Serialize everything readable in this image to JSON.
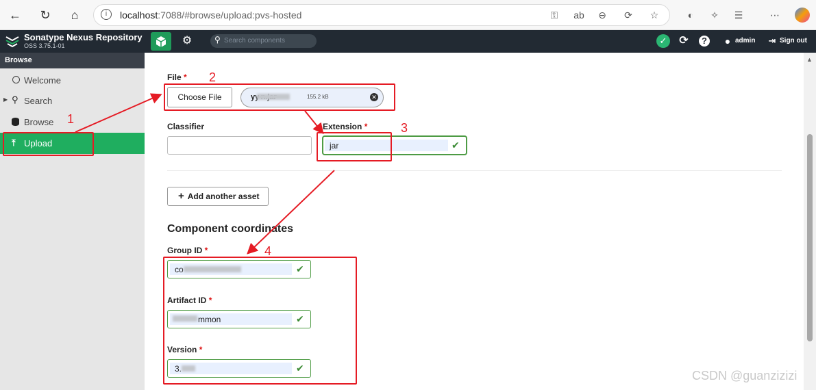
{
  "browser": {
    "url_host": "localhost",
    "url_rest": ":7088/#browse/upload:pvs-hosted"
  },
  "header": {
    "title": "Sonatype Nexus Repository",
    "version": "OSS 3.75.1-01",
    "search_placeholder": "Search components",
    "user": "admin",
    "sign_out": "Sign out"
  },
  "sidebar": {
    "header": "Browse",
    "items": [
      {
        "label": "Welcome",
        "icon": "circle-icon"
      },
      {
        "label": "Search",
        "icon": "search-icon"
      },
      {
        "label": "Browse",
        "icon": "database-icon"
      },
      {
        "label": "Upload",
        "icon": "upload-icon"
      }
    ]
  },
  "form": {
    "file_label": "File",
    "choose_file": "Choose File",
    "file_name": "yy n.jar",
    "file_size": "155.2 kB",
    "classifier_label": "Classifier",
    "classifier_value": "",
    "extension_label": "Extension",
    "extension_value": "jar",
    "add_asset": "Add another asset",
    "coordinates_title": "Component coordinates",
    "group_label": "Group ID",
    "group_value": "co",
    "artifact_label": "Artifact ID",
    "artifact_value": "mmon",
    "version_label": "Version",
    "version_value": "3."
  },
  "annotations": [
    "1",
    "2",
    "3",
    "4"
  ],
  "watermark": "CSDN @guanzizizi",
  "colors": {
    "header": "#222a33",
    "accent": "#1fae5f",
    "annotation": "#e51b24"
  }
}
